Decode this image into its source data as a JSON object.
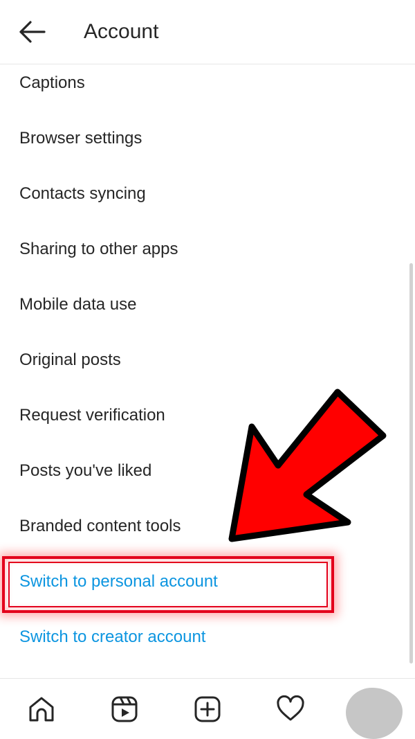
{
  "header": {
    "title": "Account",
    "back_icon": "arrow-left-icon"
  },
  "settings": {
    "items": [
      {
        "label": "Captions"
      },
      {
        "label": "Browser settings"
      },
      {
        "label": "Contacts syncing"
      },
      {
        "label": "Sharing to other apps"
      },
      {
        "label": "Mobile data use"
      },
      {
        "label": "Original posts"
      },
      {
        "label": "Request verification"
      },
      {
        "label": "Posts you've liked"
      },
      {
        "label": "Branded content tools"
      },
      {
        "label": "Switch to personal account",
        "style": "link",
        "highlighted": true
      },
      {
        "label": "Switch to creator account",
        "style": "link"
      }
    ]
  },
  "bottom_nav": {
    "icons": [
      "home-icon",
      "reels-icon",
      "create-post-icon",
      "activity-heart-icon",
      "profile-avatar"
    ]
  },
  "colors": {
    "text": "#262626",
    "link": "#0c95e0",
    "highlight": "#e3001b",
    "arrow_fill": "#ff0000",
    "divider": "#e6e6e6"
  }
}
